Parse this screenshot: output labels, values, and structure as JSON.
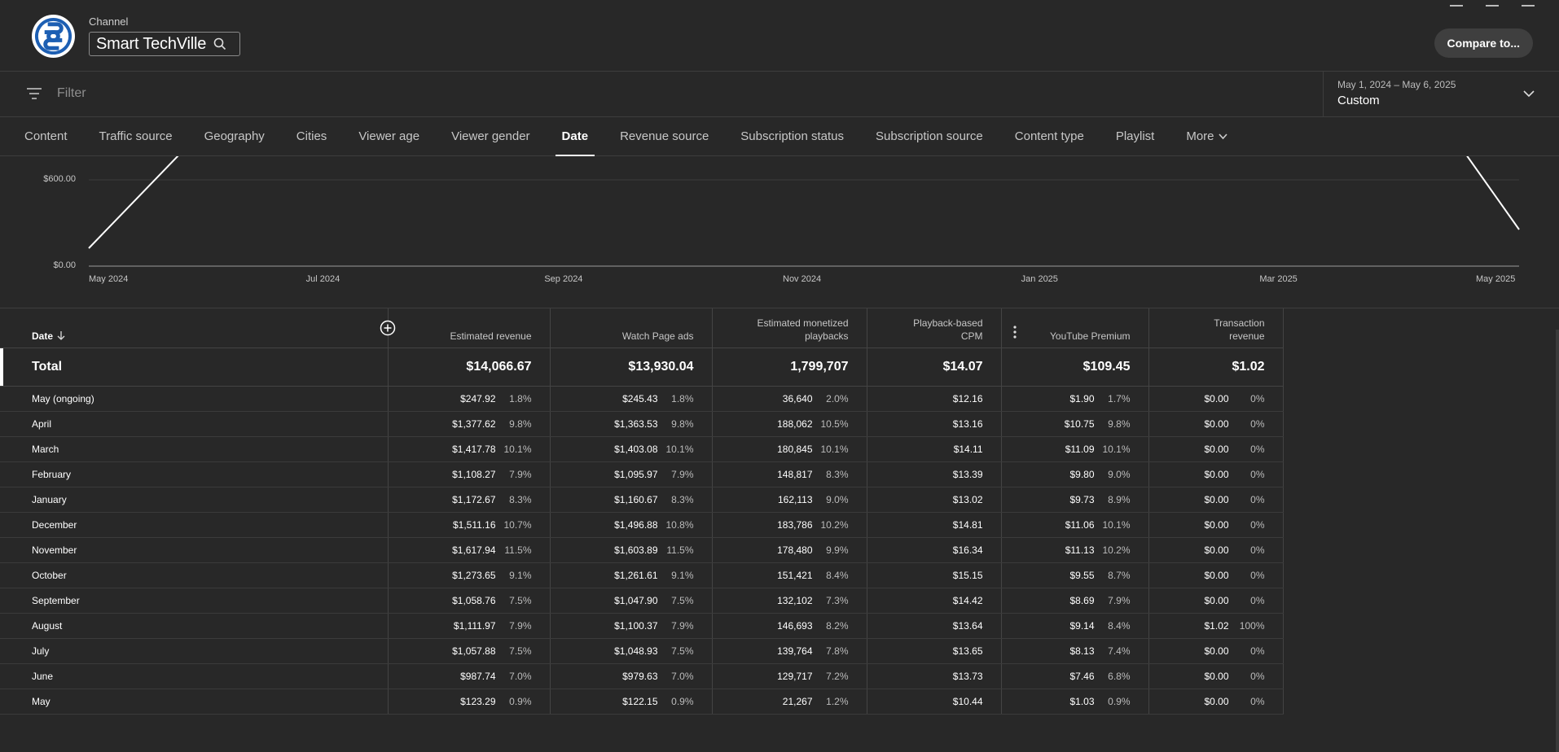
{
  "header": {
    "channel_label": "Channel",
    "channel_name": "Smart TechVille",
    "compare_label": "Compare to..."
  },
  "filter": {
    "placeholder": "Filter",
    "date_range": "May 1, 2024 – May 6, 2025",
    "date_mode": "Custom"
  },
  "tabs": [
    {
      "label": "Content"
    },
    {
      "label": "Traffic source"
    },
    {
      "label": "Geography"
    },
    {
      "label": "Cities"
    },
    {
      "label": "Viewer age"
    },
    {
      "label": "Viewer gender"
    },
    {
      "label": "Date"
    },
    {
      "label": "Revenue source"
    },
    {
      "label": "Subscription status"
    },
    {
      "label": "Subscription source"
    },
    {
      "label": "Content type"
    },
    {
      "label": "Playlist"
    },
    {
      "label": "More"
    }
  ],
  "active_tab": "Date",
  "chart_data": {
    "type": "line",
    "y_tick_labels": [
      "$600.00",
      "$0.00"
    ],
    "x_tick_labels": [
      "May 2024",
      "Jul 2024",
      "Sep 2024",
      "Nov 2024",
      "Jan 2025",
      "Mar 2025",
      "May 2025"
    ],
    "line_color": "#ffffff"
  },
  "table": {
    "columns": {
      "date": "Date",
      "revenue": "Estimated revenue",
      "watch_page_ads": "Watch Page ads",
      "monetized_playbacks_1": "Estimated monetized",
      "monetized_playbacks_2": "playbacks",
      "cpm_1": "Playback-based",
      "cpm_2": "CPM",
      "premium": "YouTube Premium",
      "transaction_1": "Transaction",
      "transaction_2": "revenue"
    },
    "total": {
      "label": "Total",
      "revenue": "$14,066.67",
      "watch_page_ads": "$13,930.04",
      "playbacks": "1,799,707",
      "cpm": "$14.07",
      "premium": "$109.45",
      "transaction": "$1.02"
    },
    "rows": [
      {
        "date": "May (ongoing)",
        "rev": "$247.92",
        "rev_p": "1.8%",
        "ads": "$245.43",
        "ads_p": "1.8%",
        "pb": "36,640",
        "pb_p": "2.0%",
        "cpm": "$12.16",
        "prem": "$1.90",
        "prem_p": "1.7%",
        "tx": "$0.00",
        "tx_p": "0%"
      },
      {
        "date": "April",
        "rev": "$1,377.62",
        "rev_p": "9.8%",
        "ads": "$1,363.53",
        "ads_p": "9.8%",
        "pb": "188,062",
        "pb_p": "10.5%",
        "cpm": "$13.16",
        "prem": "$10.75",
        "prem_p": "9.8%",
        "tx": "$0.00",
        "tx_p": "0%"
      },
      {
        "date": "March",
        "rev": "$1,417.78",
        "rev_p": "10.1%",
        "ads": "$1,403.08",
        "ads_p": "10.1%",
        "pb": "180,845",
        "pb_p": "10.1%",
        "cpm": "$14.11",
        "prem": "$11.09",
        "prem_p": "10.1%",
        "tx": "$0.00",
        "tx_p": "0%"
      },
      {
        "date": "February",
        "rev": "$1,108.27",
        "rev_p": "7.9%",
        "ads": "$1,095.97",
        "ads_p": "7.9%",
        "pb": "148,817",
        "pb_p": "8.3%",
        "cpm": "$13.39",
        "prem": "$9.80",
        "prem_p": "9.0%",
        "tx": "$0.00",
        "tx_p": "0%"
      },
      {
        "date": "January",
        "rev": "$1,172.67",
        "rev_p": "8.3%",
        "ads": "$1,160.67",
        "ads_p": "8.3%",
        "pb": "162,113",
        "pb_p": "9.0%",
        "cpm": "$13.02",
        "prem": "$9.73",
        "prem_p": "8.9%",
        "tx": "$0.00",
        "tx_p": "0%"
      },
      {
        "date": "December",
        "rev": "$1,511.16",
        "rev_p": "10.7%",
        "ads": "$1,496.88",
        "ads_p": "10.8%",
        "pb": "183,786",
        "pb_p": "10.2%",
        "cpm": "$14.81",
        "prem": "$11.06",
        "prem_p": "10.1%",
        "tx": "$0.00",
        "tx_p": "0%"
      },
      {
        "date": "November",
        "rev": "$1,617.94",
        "rev_p": "11.5%",
        "ads": "$1,603.89",
        "ads_p": "11.5%",
        "pb": "178,480",
        "pb_p": "9.9%",
        "cpm": "$16.34",
        "prem": "$11.13",
        "prem_p": "10.2%",
        "tx": "$0.00",
        "tx_p": "0%"
      },
      {
        "date": "October",
        "rev": "$1,273.65",
        "rev_p": "9.1%",
        "ads": "$1,261.61",
        "ads_p": "9.1%",
        "pb": "151,421",
        "pb_p": "8.4%",
        "cpm": "$15.15",
        "prem": "$9.55",
        "prem_p": "8.7%",
        "tx": "$0.00",
        "tx_p": "0%"
      },
      {
        "date": "September",
        "rev": "$1,058.76",
        "rev_p": "7.5%",
        "ads": "$1,047.90",
        "ads_p": "7.5%",
        "pb": "132,102",
        "pb_p": "7.3%",
        "cpm": "$14.42",
        "prem": "$8.69",
        "prem_p": "7.9%",
        "tx": "$0.00",
        "tx_p": "0%"
      },
      {
        "date": "August",
        "rev": "$1,111.97",
        "rev_p": "7.9%",
        "ads": "$1,100.37",
        "ads_p": "7.9%",
        "pb": "146,693",
        "pb_p": "8.2%",
        "cpm": "$13.64",
        "prem": "$9.14",
        "prem_p": "8.4%",
        "tx": "$1.02",
        "tx_p": "100%"
      },
      {
        "date": "July",
        "rev": "$1,057.88",
        "rev_p": "7.5%",
        "ads": "$1,048.93",
        "ads_p": "7.5%",
        "pb": "139,764",
        "pb_p": "7.8%",
        "cpm": "$13.65",
        "prem": "$8.13",
        "prem_p": "7.4%",
        "tx": "$0.00",
        "tx_p": "0%"
      },
      {
        "date": "June",
        "rev": "$987.74",
        "rev_p": "7.0%",
        "ads": "$979.63",
        "ads_p": "7.0%",
        "pb": "129,717",
        "pb_p": "7.2%",
        "cpm": "$13.73",
        "prem": "$7.46",
        "prem_p": "6.8%",
        "tx": "$0.00",
        "tx_p": "0%"
      },
      {
        "date": "May",
        "rev": "$123.29",
        "rev_p": "0.9%",
        "ads": "$122.15",
        "ads_p": "0.9%",
        "pb": "21,267",
        "pb_p": "1.2%",
        "cpm": "$10.44",
        "prem": "$1.03",
        "prem_p": "0.9%",
        "tx": "$0.00",
        "tx_p": "0%"
      }
    ]
  }
}
